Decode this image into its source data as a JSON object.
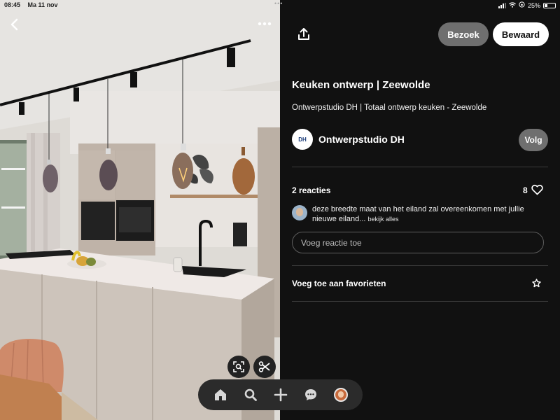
{
  "status_bar": {
    "time": "08:45",
    "date": "Ma 11 nov",
    "battery_percent": "25%",
    "dots": "•••"
  },
  "image": {
    "description_icons": [
      "back-arrow-icon",
      "more-options-icon",
      "visual-search-icon",
      "scissors-icon"
    ],
    "back_glyph": "‹",
    "more_glyph": "•••"
  },
  "bottom_nav": {
    "items": [
      "home-icon",
      "search-icon",
      "plus-icon",
      "messages-icon",
      "profile-avatar"
    ]
  },
  "header": {
    "visit_label": "Bezoek",
    "save_label": "Bewaard"
  },
  "pin": {
    "title": "Keuken ontwerp | Zeewolde",
    "description": "Ontwerpstudio DH | Totaal ontwerp keuken - Zeewolde"
  },
  "creator": {
    "name": "Ontwerpstudio DH",
    "logo_text": "DH",
    "follow_label": "Volg"
  },
  "comments": {
    "heading": "2 reacties",
    "like_count": "8",
    "first_comment": "deze breedte maat van het eiland zal overeenkomen met jullie nieuwe eiland...",
    "see_all_label": "bekijk alles",
    "input_placeholder": "Voeg reactie toe"
  },
  "favorites": {
    "label": "Voeg toe aan favorieten"
  },
  "colors": {
    "background": "#111111",
    "button_gray": "#6f6f6f",
    "save_button": "#ffffff",
    "divider": "#3c3c3c"
  }
}
